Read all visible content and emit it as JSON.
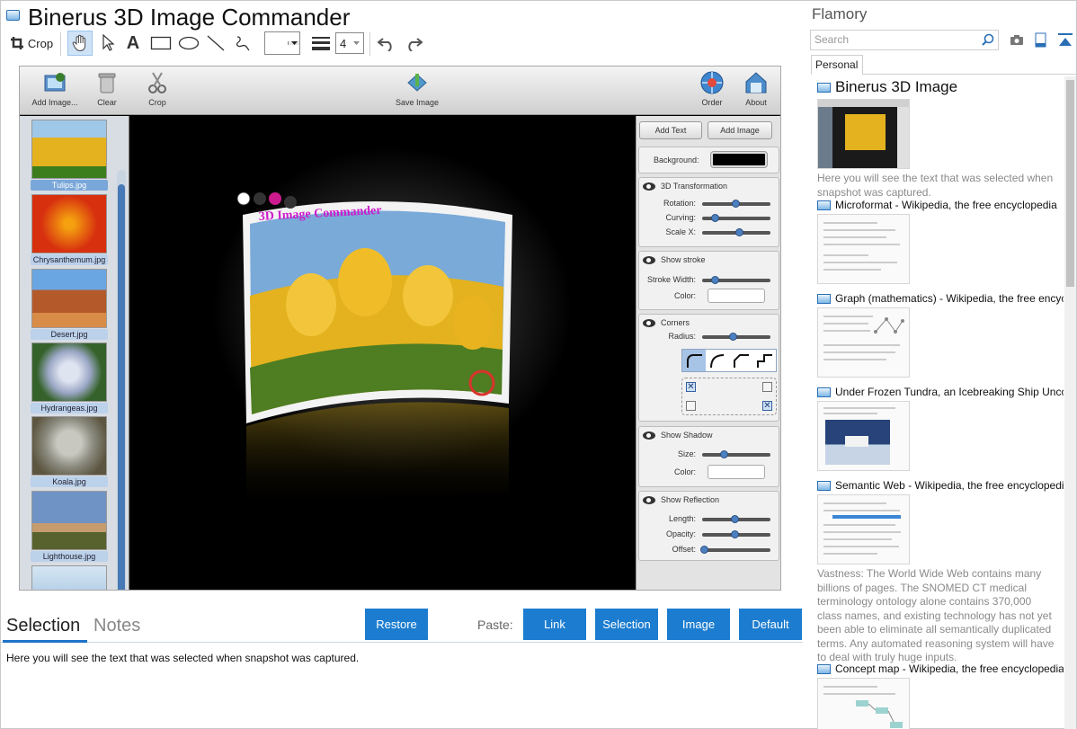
{
  "window": {
    "title": "Binerus 3D Image Commander"
  },
  "toolbar": {
    "crop_label": "Crop",
    "line_width": "4",
    "text_tool_glyph": "A",
    "stroke_color": "#ff0000"
  },
  "app": {
    "buttons": {
      "add_image": "Add Image...",
      "clear": "Clear",
      "crop": "Crop",
      "save_image": "Save Image",
      "order": "Order",
      "about": "About"
    },
    "thumbnails": [
      {
        "label": "Tulips.jpg",
        "color": "#e3b21e",
        "selected": true
      },
      {
        "label": "Chrysanthemum.jpg",
        "color": "#d7300f",
        "selected": false
      },
      {
        "label": "Desert.jpg",
        "color": "#b45a2a",
        "selected": false
      },
      {
        "label": "Hydrangeas.jpg",
        "color": "#9aa6c4",
        "selected": false
      },
      {
        "label": "Koala.jpg",
        "color": "#8a8a7e",
        "selected": false
      },
      {
        "label": "Lighthouse.jpg",
        "color": "#6f93c4",
        "selected": false
      }
    ],
    "canvas": {
      "overlay_text": "3D Image Commander",
      "overlay_color": "#cc1bcc"
    },
    "panel": {
      "add_text": "Add Text",
      "add_image": "Add Image",
      "background_label": "Background:",
      "transform": {
        "title": "3D Transformation",
        "rotation": "Rotation:",
        "curving": "Curving:",
        "scale_x": "Scale X:"
      },
      "stroke": {
        "title": "Show stroke",
        "width": "Stroke Width:",
        "color": "Color:"
      },
      "corners": {
        "title": "Corners",
        "radius": "Radius:"
      },
      "shadow": {
        "title": "Show Shadow",
        "size": "Size:",
        "color": "Color:"
      },
      "reflection": {
        "title": "Show Reflection",
        "length": "Length:",
        "opacity": "Opacity:",
        "offset": "Offset:"
      }
    }
  },
  "bottom": {
    "tab_selection": "Selection",
    "tab_notes": "Notes",
    "restore": "Restore",
    "paste_label": "Paste:",
    "paste_link": "Link",
    "paste_selection": "Selection",
    "paste_image": "Image",
    "paste_default": "Default",
    "selection_text": "Here you will see the text that was selected when snapshot was captured."
  },
  "sidebar": {
    "title": "Flamory",
    "search_placeholder": "Search",
    "tab_personal": "Personal",
    "items": [
      {
        "title": "Binerus 3D Image",
        "desc": "Here you will see the text that was selected when snapshot was captured."
      },
      {
        "title": "Microformat - Wikipedia, the free encyclopedia",
        "desc": ""
      },
      {
        "title": "Graph (mathematics) - Wikipedia, the free encyclopedia",
        "desc": ""
      },
      {
        "title": "Under Frozen Tundra, an Icebreaking Ship Uncovers",
        "desc": ""
      },
      {
        "title": "Semantic Web - Wikipedia, the free encyclopedia",
        "desc": "Vastness: The World Wide Web contains many billions of pages. The SNOMED CT medical terminology ontology alone contains 370,000 class names, and existing technology has not yet been able to eliminate all semantically duplicated terms. Any automated reasoning system will have to deal with truly huge inputs."
      },
      {
        "title": "Concept map - Wikipedia, the free encyclopedia",
        "desc": ""
      }
    ]
  }
}
